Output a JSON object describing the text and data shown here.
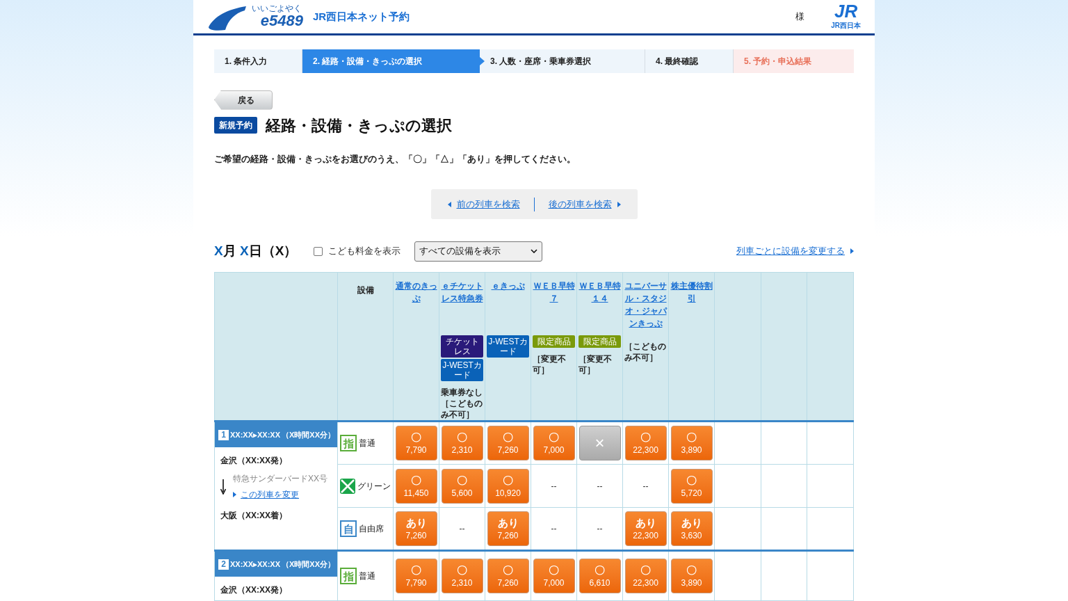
{
  "header": {
    "logo_kana": "いいごよやく",
    "logo_text": "e5489",
    "site_name": "JR西日本ネット予約",
    "user_suffix": "様",
    "jr_mark": "JR",
    "jr_caption": "JR西日本"
  },
  "steps": [
    {
      "label": "1.  条件入力",
      "kind": "normal",
      "selected": false
    },
    {
      "label": "2.  経路・設備・きっぷの選択",
      "kind": "normal",
      "selected": true
    },
    {
      "label": "3.  人数・座席・乗車券選択",
      "kind": "normal",
      "selected": false
    },
    {
      "label": "4.  最終確認",
      "kind": "normal",
      "selected": false
    },
    {
      "label": "5.  予約・申込結果",
      "kind": "final",
      "selected": false
    }
  ],
  "back_button": "戻る",
  "badge": "新規予約",
  "title": "経路・設備・きっぷの選択",
  "instruction": "ご希望の経路・設備・きっぷをお選びのうえ、「〇」「△」「あり」を押してください。",
  "train_nav": {
    "previous": "前の列車を検索",
    "next": "後の列車を検索"
  },
  "date": {
    "month": "X",
    "month_unit": "月",
    "day": "X",
    "day_unit": "日",
    "weekday": "（X）"
  },
  "child_fare": {
    "label": "こども料金を表示",
    "checked": false
  },
  "facility_select": {
    "value": "すべての設備を表示"
  },
  "change_link": "列車ごとに設備を変更する",
  "table": {
    "facility_heading": "設備",
    "ticket_columns": [
      {
        "name": "通常のきっぷ"
      },
      {
        "name": "ｅチケットレス特急券",
        "tags": [
          {
            "text": "チケットレス",
            "color": "#2a1a7a"
          },
          {
            "text": "J-WESTカード",
            "color": "#0a62b8"
          }
        ],
        "notes": [
          "乗車券なし",
          "［こどものみ不可］"
        ]
      },
      {
        "name": "ｅきっぷ",
        "tags": [
          {
            "text": "J-WESTカード",
            "color": "#0a62b8"
          }
        ]
      },
      {
        "name": "ＷＥＢ早特７",
        "tags": [
          {
            "text": "限定商品",
            "color": "#7a9a0a"
          }
        ],
        "notes": [
          "［変更不可］"
        ]
      },
      {
        "name": "ＷＥＢ早特１４",
        "tags": [
          {
            "text": "限定商品",
            "color": "#7a9a0a"
          }
        ],
        "notes": [
          "［変更不可］"
        ]
      },
      {
        "name": "ユニバーサル・スタジオ・ジャパンきっぷ",
        "notes": [
          "［こどものみ不可］"
        ]
      },
      {
        "name": "株主優待割引"
      }
    ],
    "trains": [
      {
        "number": "1",
        "times": "XX:XX▸XX:XX",
        "duration": "（X時間XX分）",
        "departure": "金沢（XX:XX発）",
        "train_name": "特急サンダーバードXX号",
        "change_train": "この列車を変更",
        "arrival": "大阪（XX:XX着）",
        "seats": [
          {
            "kind": "reserved",
            "icon": "指",
            "label": "普通",
            "cells": [
              {
                "kind": "available",
                "mark": "〇",
                "price": "7,790"
              },
              {
                "kind": "available",
                "mark": "〇",
                "price": "2,310"
              },
              {
                "kind": "available",
                "mark": "〇",
                "price": "7,260"
              },
              {
                "kind": "available",
                "mark": "〇",
                "price": "7,000"
              },
              {
                "kind": "soldout",
                "mark": "×"
              },
              {
                "kind": "available",
                "mark": "〇",
                "price": "22,300"
              },
              {
                "kind": "available",
                "mark": "〇",
                "price": "3,890"
              }
            ]
          },
          {
            "kind": "green",
            "label": "グリーン",
            "cells": [
              {
                "kind": "available",
                "mark": "〇",
                "price": "11,450"
              },
              {
                "kind": "available",
                "mark": "〇",
                "price": "5,600"
              },
              {
                "kind": "available",
                "mark": "〇",
                "price": "10,920"
              },
              {
                "kind": "none",
                "text": "--"
              },
              {
                "kind": "none",
                "text": "--"
              },
              {
                "kind": "none",
                "text": "--"
              },
              {
                "kind": "available",
                "mark": "〇",
                "price": "5,720"
              }
            ]
          },
          {
            "kind": "free",
            "icon": "自",
            "label": "自由席",
            "cells": [
              {
                "kind": "available",
                "mark": "あり",
                "price": "7,260"
              },
              {
                "kind": "none",
                "text": "--"
              },
              {
                "kind": "available",
                "mark": "あり",
                "price": "7,260"
              },
              {
                "kind": "none",
                "text": "--"
              },
              {
                "kind": "none",
                "text": "--"
              },
              {
                "kind": "available",
                "mark": "あり",
                "price": "22,300"
              },
              {
                "kind": "available",
                "mark": "あり",
                "price": "3,630"
              }
            ]
          }
        ]
      },
      {
        "number": "2",
        "times": "XX:XX▸XX:XX",
        "duration": "（X時間XX分）",
        "departure": "金沢（XX:XX発）",
        "seats": [
          {
            "kind": "reserved",
            "icon": "指",
            "label": "普通",
            "cells": [
              {
                "kind": "available",
                "mark": "〇",
                "price": "7,790"
              },
              {
                "kind": "available",
                "mark": "〇",
                "price": "2,310"
              },
              {
                "kind": "available",
                "mark": "〇",
                "price": "7,260"
              },
              {
                "kind": "available",
                "mark": "〇",
                "price": "7,000"
              },
              {
                "kind": "available",
                "mark": "〇",
                "price": "6,610"
              },
              {
                "kind": "available",
                "mark": "〇",
                "price": "22,300"
              },
              {
                "kind": "available",
                "mark": "〇",
                "price": "3,890"
              }
            ]
          }
        ]
      }
    ]
  }
}
